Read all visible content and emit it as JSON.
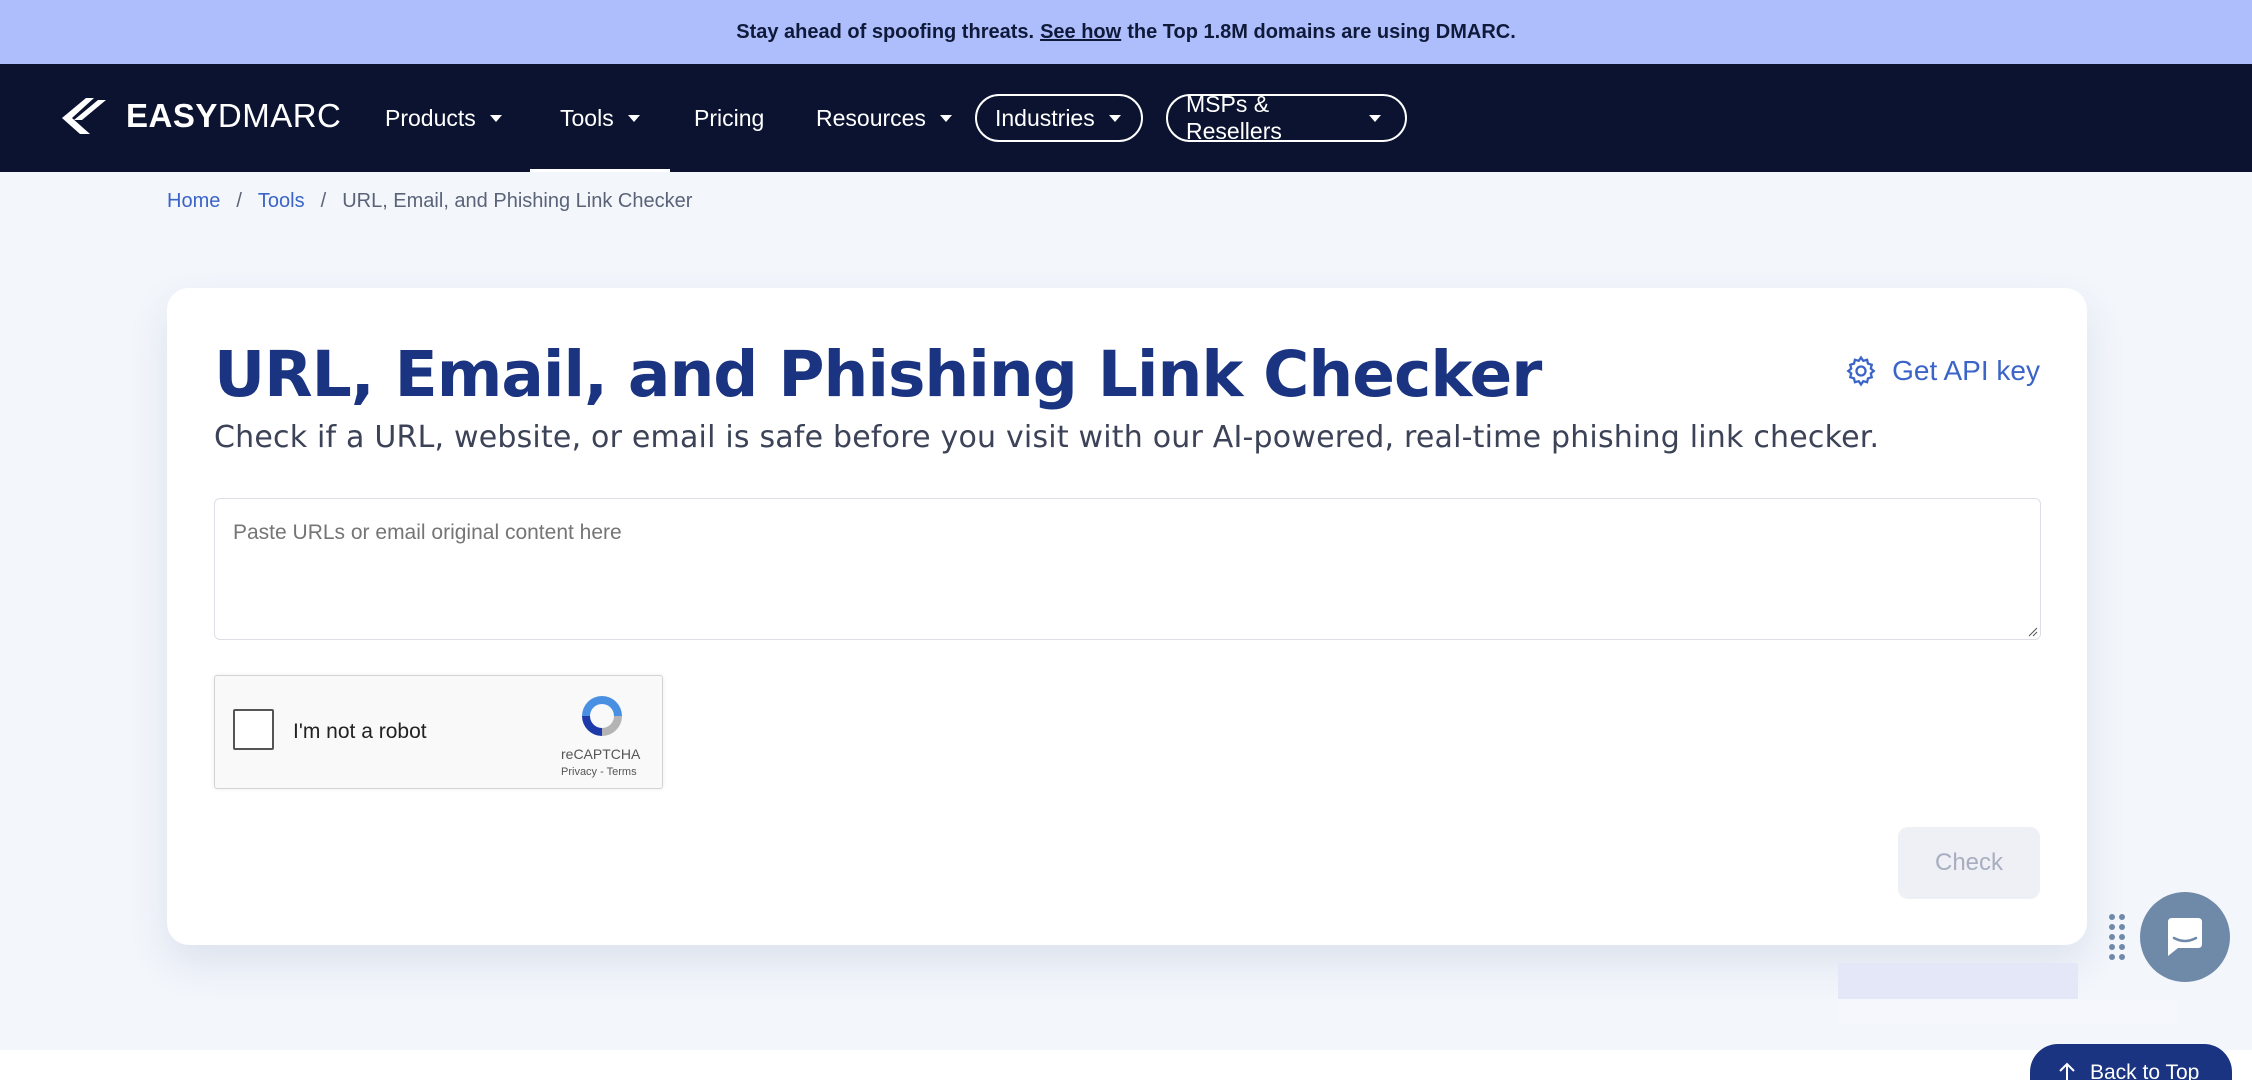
{
  "banner": {
    "text_before": "Stay ahead of spoofing threats.",
    "link": "See how",
    "text_after": "the Top 1.8M domains are using DMARC."
  },
  "logo": {
    "bold": "EASY",
    "light": "DMARC"
  },
  "nav": {
    "products": "Products",
    "tools": "Tools",
    "pricing": "Pricing",
    "resources": "Resources",
    "industries": "Industries",
    "msps": "MSPs & Resellers"
  },
  "breadcrumb": {
    "home": "Home",
    "tools": "Tools",
    "current": "URL, Email, and Phishing Link Checker",
    "separator": "/"
  },
  "card": {
    "title": "URL, Email, and Phishing Link Checker",
    "subtitle": "Check if a URL, website, or email is safe before you visit with our AI-powered, real-time phishing link checker.",
    "api_key": "Get API key",
    "input_placeholder": "Paste URLs or email original content here",
    "check_button": "Check"
  },
  "captcha": {
    "label": "I'm not a robot",
    "brand": "reCAPTCHA",
    "links": "Privacy - Terms"
  },
  "back_to_top": "Back to Top",
  "colors": {
    "banner_bg": "#aebdfb",
    "nav_bg": "#0b1330",
    "title": "#1b3481",
    "link": "#3b64c8"
  }
}
